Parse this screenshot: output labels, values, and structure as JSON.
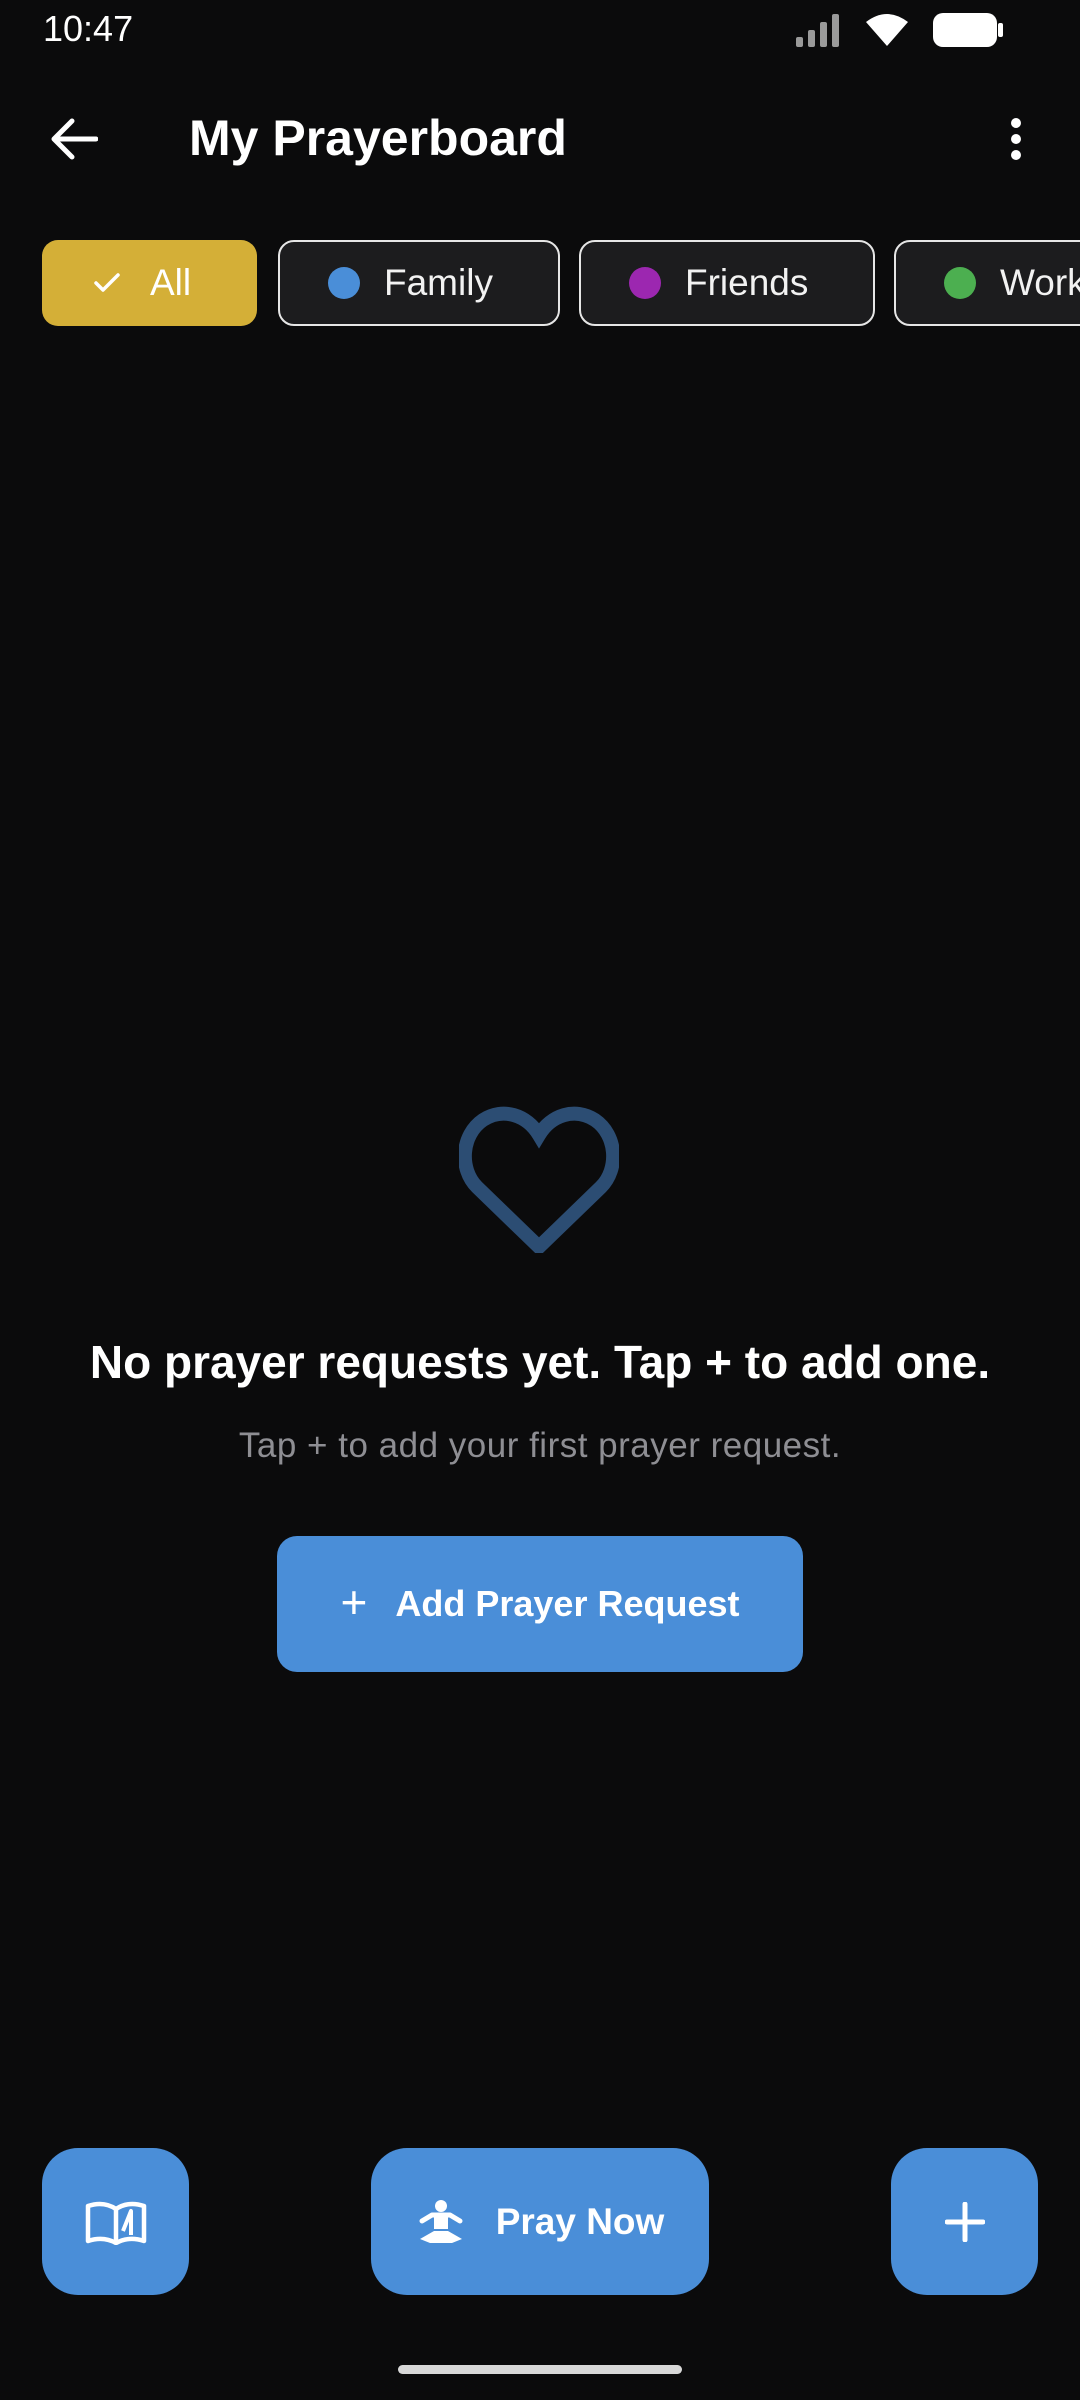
{
  "status_bar": {
    "time": "10:47",
    "icons": [
      "cellular-signal-icon",
      "wifi-icon",
      "battery-icon"
    ]
  },
  "header": {
    "title": "My Prayerboard",
    "back_icon": "arrow-left-icon",
    "menu_icon": "more-vertical-icon"
  },
  "filters": {
    "chips": [
      {
        "label": "All",
        "selected": true,
        "icon": "check-icon",
        "color": "#d4af37"
      },
      {
        "label": "Family",
        "selected": false,
        "dot_color": "#4a8ed8"
      },
      {
        "label": "Friends",
        "selected": false,
        "dot_color": "#9c27b0"
      },
      {
        "label": "Work",
        "selected": false,
        "dot_color": "#4caf50"
      }
    ]
  },
  "empty_state": {
    "icon": "heart-outline-icon",
    "title": "No prayer requests yet. Tap + to add one.",
    "subtitle": "Tap + to add your first prayer request.",
    "button_label": "Add Prayer Request"
  },
  "bottom_actions": {
    "left_icon": "open-book-icon",
    "center_label": "Pray Now",
    "center_icon": "meditation-icon",
    "right_icon": "plus-icon"
  },
  "colors": {
    "accent": "#4a8ed8",
    "selected_chip": "#d4af37",
    "background": "#0b0b0c",
    "heart": "#2c4d73"
  }
}
